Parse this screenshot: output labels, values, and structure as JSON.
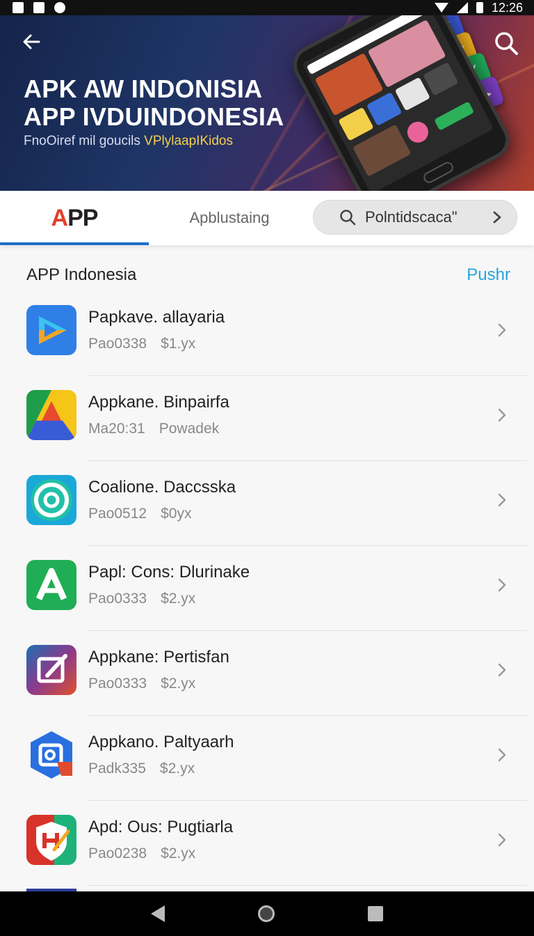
{
  "status_bar": {
    "time": "12:26"
  },
  "header": {
    "title_line1": "APK AW INDONISIA",
    "title_line2": "APP IVDUINDONESIA",
    "subtitle_prefix": "FnoOiref mil goucils ",
    "subtitle_highlight": "VPlylaapIKidos",
    "back_icon": "arrow-left-icon",
    "search_icon": "search-icon"
  },
  "tabs": {
    "app_tab_label_a": "A",
    "app_tab_label_b": "PP",
    "second_tab_label": "Apblustaing",
    "search_pill_text": "Polntidscaca\""
  },
  "section": {
    "title": "APP Indonesia",
    "action": "Pushr"
  },
  "apps": [
    {
      "name": "Papkave. allayaria",
      "code": "Pao0338",
      "price": "$1.yx",
      "icon": "play-triangle-icon"
    },
    {
      "name": "Appkane. Binpairfa",
      "code": "Ma20:31",
      "price": "Powadek",
      "icon": "drive-triangle-icon"
    },
    {
      "name": "Coalione. Daccsska",
      "code": "Pao0512",
      "price": "$0yx",
      "icon": "ring-icon"
    },
    {
      "name": "Papl: Cons: Dlurinake",
      "code": "Pao0333",
      "price": "$2.yx",
      "icon": "letter-a-icon"
    },
    {
      "name": "Appkane: Pertisfan",
      "code": "Pao0333",
      "price": "$2.yx",
      "icon": "edit-square-icon"
    },
    {
      "name": "Appkano. Paltyaarh",
      "code": "Padk335",
      "price": "$2.yx",
      "icon": "hexagon-app-icon"
    },
    {
      "name": "Apd: Ous: Pugtiarla",
      "code": "Pao0238",
      "price": "$2.yx",
      "icon": "shield-icon"
    }
  ],
  "colors": {
    "accent": "#27a4dc",
    "tab_underline": "#1e70c8",
    "brand_red": "#e2402c"
  }
}
